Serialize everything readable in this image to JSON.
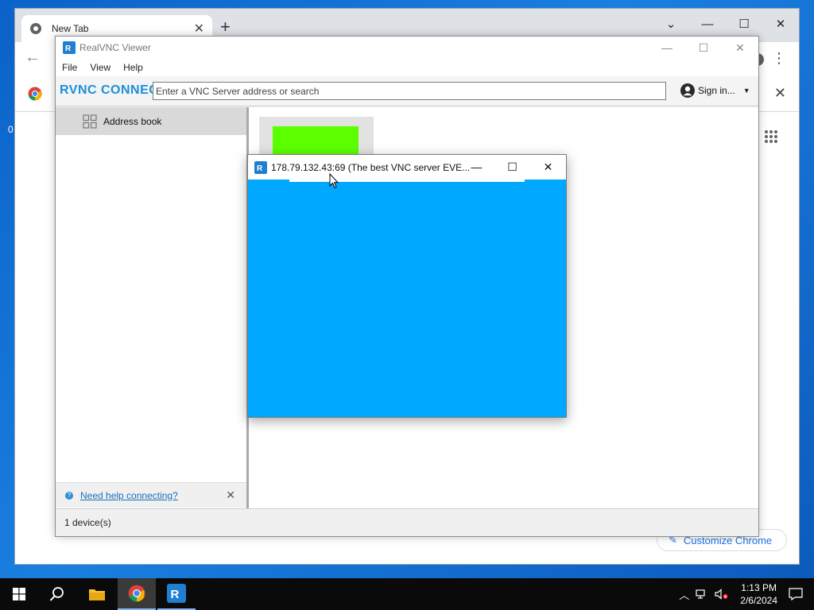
{
  "chrome": {
    "tab_title": "New Tab",
    "new_tab_symbol": "+",
    "customize_label": "Customize Chrome"
  },
  "desktop": {
    "fragment_1": "0"
  },
  "vnc_viewer": {
    "title": "RealVNC Viewer",
    "menu": [
      "File",
      "View",
      "Help"
    ],
    "brand": "RVNC CONNECT",
    "search_placeholder": "Enter a VNC Server address or search",
    "sign_in_label": "Sign in...",
    "sidebar": {
      "address_book_label": "Address book",
      "help_link": "Need help connecting?"
    },
    "status": "1 device(s)"
  },
  "session": {
    "title": "178.79.132.43:69 (The best VNC server EVE..."
  },
  "taskbar": {
    "clock_time": "1:13 PM",
    "clock_date": "2/6/2024"
  },
  "colors": {
    "remote_screen": "#00a8ff",
    "thumbnail_green": "#5cff00",
    "vnc_brand": "#1a8fd8",
    "link": "#1a6fb8"
  }
}
